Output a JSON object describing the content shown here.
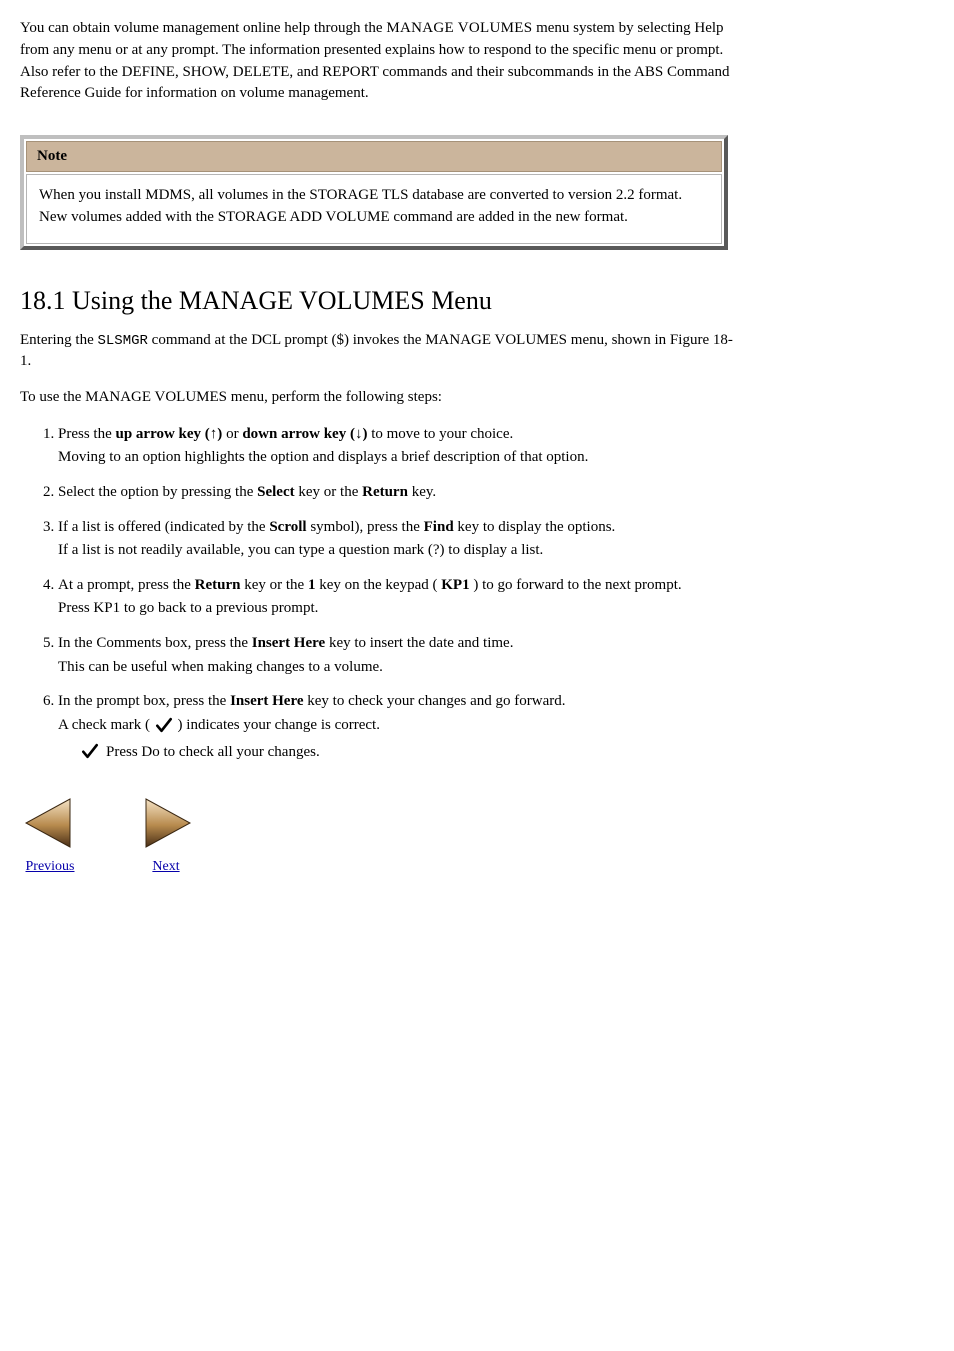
{
  "intro": {
    "line1": "You can obtain volume management online help through the ",
    "caps": "MANAGE VOLUMES",
    "line2": " menu system by selecting Help from any menu or at any prompt. The information presented explains how to respond to the specific menu or prompt. Also refer to the DEFINE, SHOW, DELETE, and REPORT commands and their subcommands in the ABS Command Reference Guide for information on volume management."
  },
  "note": {
    "label": "Note",
    "body": "When you install MDMS, all volumes in the STORAGE TLS database are converted to version 2.2 format. New volumes added with the STORAGE ADD VOLUME command are added in the new format."
  },
  "section": {
    "heading": "18.1 Using the MANAGE VOLUMES Menu",
    "intro": "Entering the ",
    "intro_cmd": "SLSMGR",
    "intro_tail": " command at the DCL prompt ($) invokes the MANAGE VOLUMES menu, shown in Figure 18-1.",
    "steps_lead": "To use the MANAGE VOLUMES menu, perform the following steps:"
  },
  "steps": [
    {
      "title_a": "Press the ",
      "title_b": "up arrow key (↑)",
      "title_c": " or ",
      "title_d": "down arrow key (↓)",
      "title_e": " to move to your choice.",
      "desc": "Moving to an option highlights the option and displays a brief description of that option."
    },
    {
      "title_a": "Select the option by pressing the ",
      "title_b": "Select",
      "title_c": " key or the ",
      "title_d": "Return",
      "title_e": " key."
    },
    {
      "title_a": "If a list is offered (indicated by the ",
      "title_b": "Scroll",
      "title_c": " symbol), press the ",
      "title_d": "Find",
      "title_e": " key to display the options.",
      "desc": "If a list is not readily available, you can type a question mark (?) to display a list."
    },
    {
      "title_a": "At a prompt, press the ",
      "title_b": "Return",
      "title_c": " key or the ",
      "title_d": "1",
      "title_e": " key on the keypad (",
      "title_f": "KP1",
      "title_g": ") to go forward to the next prompt.",
      "desc": "Press KP1 to go back to a previous prompt."
    },
    {
      "title_a": "In the Comments box, press the ",
      "title_b": "Insert Here",
      "title_c": " key to insert the date and time.",
      "desc": "This can be useful when making changes to a volume."
    },
    {
      "title_a": "In the prompt box, press the ",
      "title_b": "Insert Here",
      "title_c": " key to check your changes and go forward.",
      "desc_a": "A check mark (",
      "desc_b": ") indicates your change is correct.",
      "substep": "Press Do to check all your changes."
    }
  ],
  "nav": {
    "prev": "Previous",
    "next": "Next"
  }
}
